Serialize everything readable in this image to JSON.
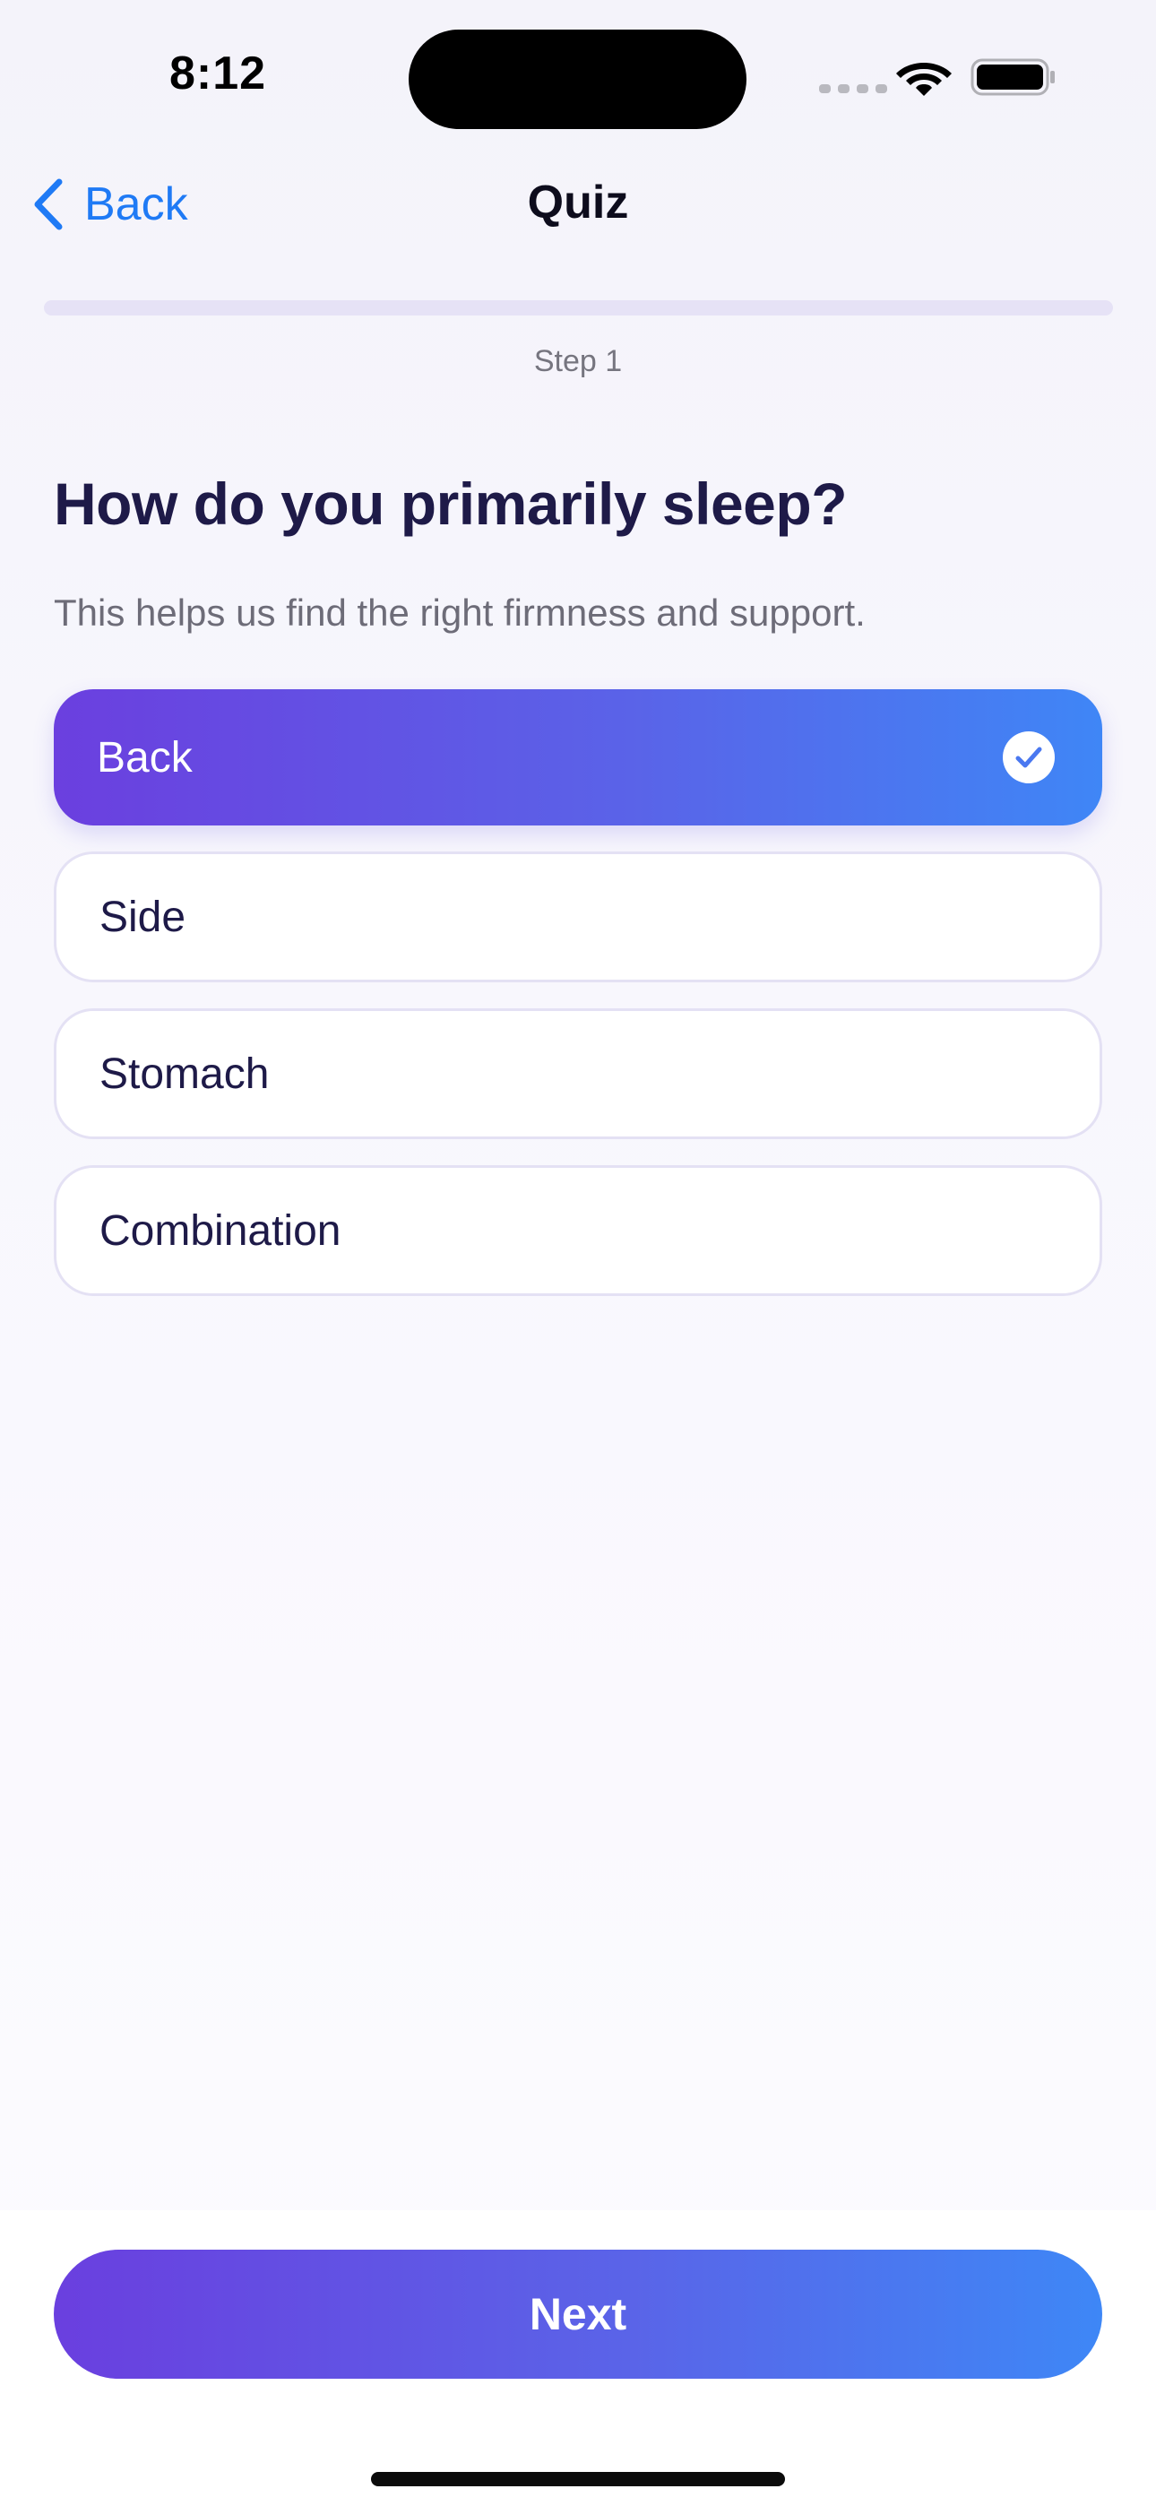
{
  "status_bar": {
    "time": "8:12",
    "signal_icon": "cellular-dots-icon",
    "wifi_icon": "wifi-icon",
    "battery_icon": "battery-icon"
  },
  "nav": {
    "back_label": "Back",
    "back_icon": "chevron-left-icon",
    "title": "Quiz"
  },
  "progress": {
    "fraction": 0,
    "step_label": "Step 1"
  },
  "question": {
    "title": "How do you primarily sleep?",
    "subtitle": "This helps us find the right firmness and support."
  },
  "options": [
    {
      "label": "Back",
      "selected": true
    },
    {
      "label": "Side",
      "selected": false
    },
    {
      "label": "Stomach",
      "selected": false
    },
    {
      "label": "Combination",
      "selected": false
    }
  ],
  "footer": {
    "next_label": "Next"
  },
  "colors": {
    "accent_start": "#6a3fdf",
    "accent_end": "#3e87f6",
    "link_blue": "#1f7af5",
    "heading": "#1e1a48"
  }
}
